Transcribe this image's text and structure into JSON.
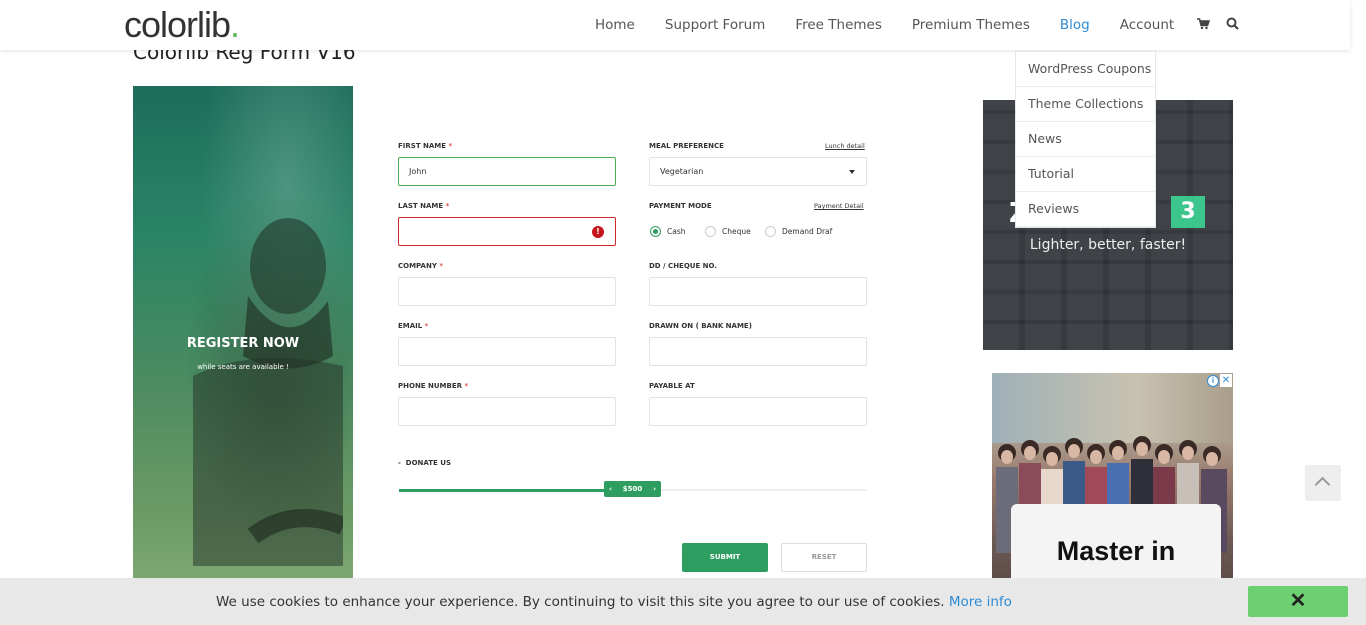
{
  "header": {
    "logo_text": "colorlib",
    "logo_dot": ".",
    "nav": [
      {
        "label": "Home"
      },
      {
        "label": "Support Forum"
      },
      {
        "label": "Free Themes"
      },
      {
        "label": "Premium Themes"
      },
      {
        "label": "Blog",
        "active": true
      },
      {
        "label": "Account"
      }
    ],
    "cart_icon": "cart-icon",
    "search_icon": "search-icon"
  },
  "blog_dropdown": [
    "WordPress Coupons",
    "Theme Collections",
    "News",
    "Tutorial",
    "Reviews"
  ],
  "page_title": "Colorlib Reg Form V16",
  "hero": {
    "title": "REGISTER NOW",
    "subtitle": "while seats are available !"
  },
  "form": {
    "first_name": {
      "label": "FIRST NAME",
      "value": "John"
    },
    "last_name": {
      "label": "LAST NAME",
      "value": ""
    },
    "company": {
      "label": "COMPANY",
      "value": ""
    },
    "email": {
      "label": "EMAIL",
      "value": ""
    },
    "phone": {
      "label": "PHONE NUMBER",
      "value": ""
    },
    "meal": {
      "label": "MEAL PREFERENCE",
      "detail_link": "Lunch detail",
      "value": "Vegetarian"
    },
    "payment": {
      "label": "PAYMENT MODE",
      "detail_link": "Payment Detail",
      "options": [
        "Cash",
        "Cheque",
        "Demand Draf"
      ],
      "selected": "Cash"
    },
    "dd_cheque": {
      "label": "DD / CHEQUE NO.",
      "value": ""
    },
    "drawn_on": {
      "label": "DRAWN ON ( BANK NAME)",
      "value": ""
    },
    "payable_at": {
      "label": "PAYABLE AT",
      "value": ""
    },
    "required_mark": "*",
    "donate": {
      "label": "DONATE US",
      "toggle": "-",
      "value_label": "$500",
      "left_arrow": "‹",
      "right_arrow": "›",
      "fill_percent": 44
    },
    "submit_label": "SUBMIT",
    "reset_label": "RESET"
  },
  "ad1": {
    "big_text": "Z",
    "badge": "3",
    "tagline": "Lighter, better, faster!"
  },
  "ad2": {
    "card_title": "Master in",
    "info": "i",
    "close": "✕"
  },
  "cookie": {
    "text": "We use cookies to enhance your experience. By continuing to visit this site you agree to our use of cookies.",
    "link": "More info",
    "close": "✕"
  },
  "colors": {
    "accent": "#2e9e60",
    "link": "#2d8cd6",
    "error": "#d0282b"
  }
}
